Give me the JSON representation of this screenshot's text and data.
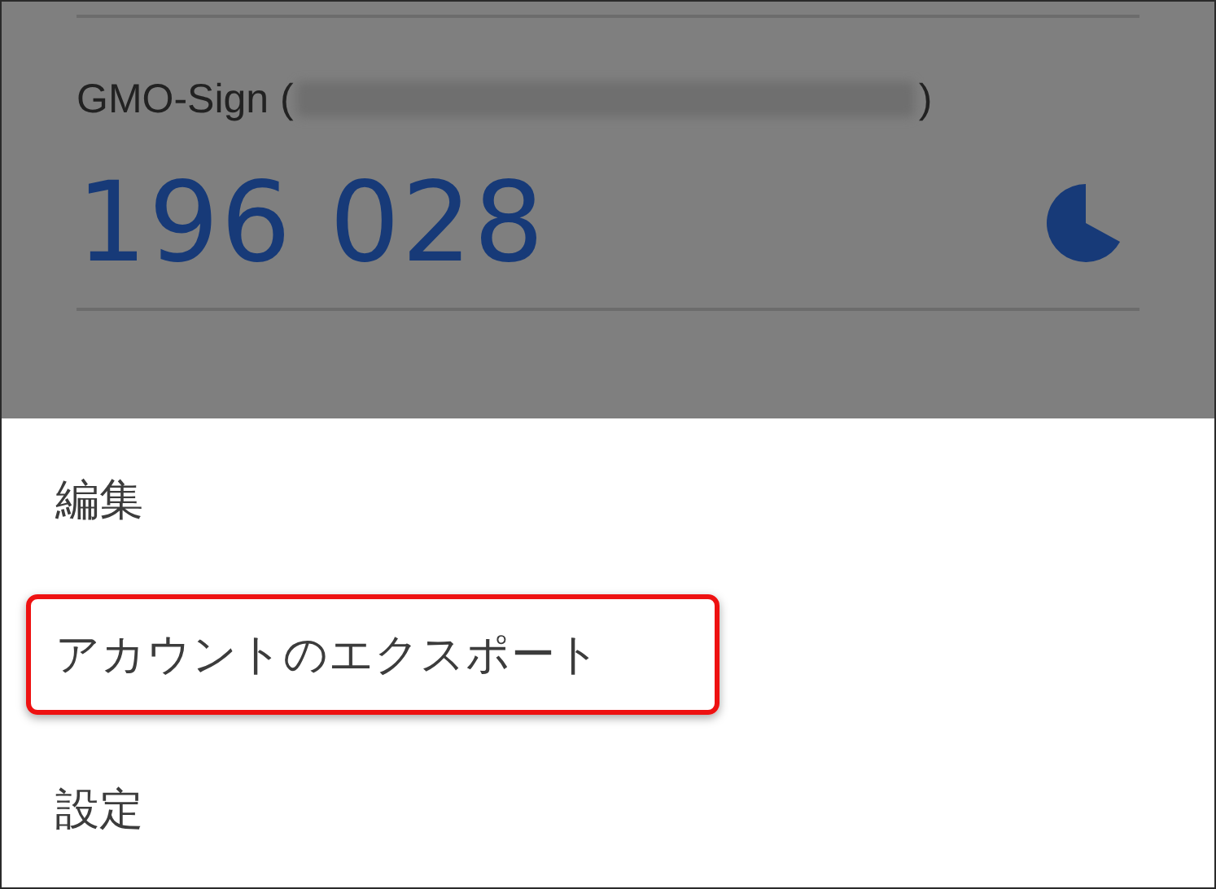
{
  "account": {
    "name": "GMO-Sign (",
    "name_end": ")",
    "code": "196 028"
  },
  "menu": [
    {
      "label": "編集",
      "highlighted": false
    },
    {
      "label": "アカウントのエクスポート",
      "highlighted": true
    },
    {
      "label": "設定",
      "highlighted": false
    }
  ]
}
